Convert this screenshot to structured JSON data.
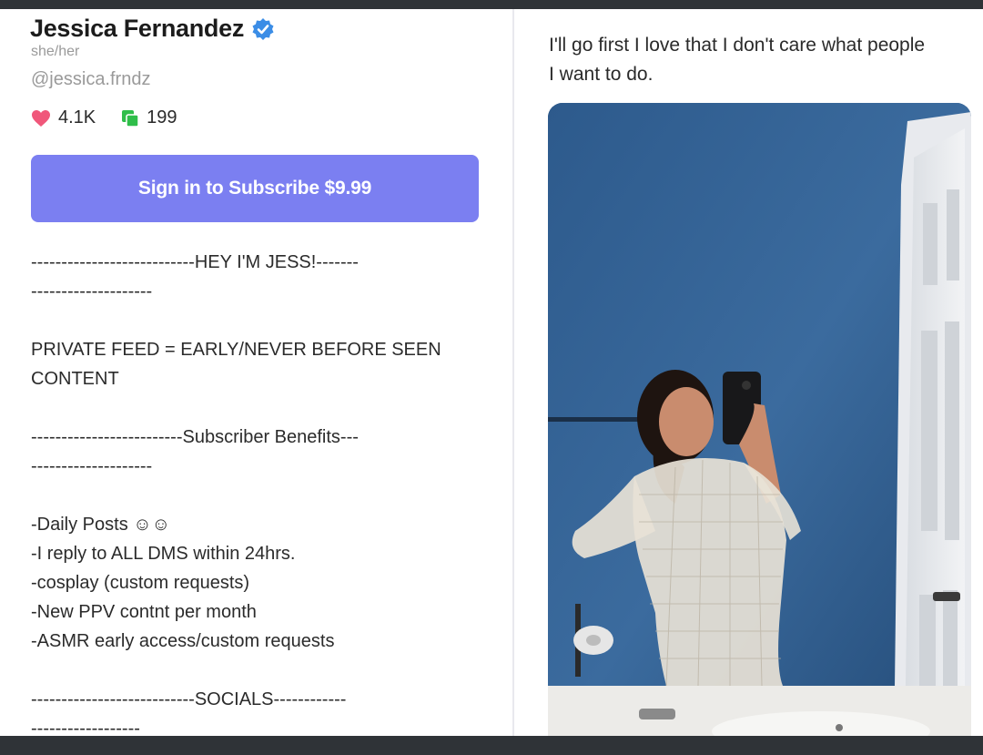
{
  "profile": {
    "name": "Jessica Fernandez",
    "pronouns": "she/her",
    "handle": "@jessica.frndz",
    "likes": "4.1K",
    "posts": "199",
    "subscribe_label": "Sign in to Subscribe $9.99"
  },
  "bio": {
    "lines": [
      "---------------------------HEY I'M JESS!-------",
      "--------------------",
      "",
      "PRIVATE FEED = EARLY/NEVER BEFORE SEEN",
      "CONTENT",
      "",
      "-------------------------Subscriber Benefits---",
      "--------------------",
      "",
      "-Daily Posts ☺☺",
      "-I reply to ALL DMS within 24hrs.",
      "-cosplay (custom requests)",
      "-New PPV contnt per month",
      "-ASMR early access/custom requests",
      "",
      "---------------------------SOCIALS------------",
      "------------------"
    ]
  },
  "post": {
    "text_line1": "I'll go first I love that I don't care what people",
    "text_line2": "I want to do."
  },
  "colors": {
    "accent": "#7b7ff1",
    "verified": "#3b8de6",
    "heart": "#f0577a",
    "posts": "#2fbe4a"
  }
}
